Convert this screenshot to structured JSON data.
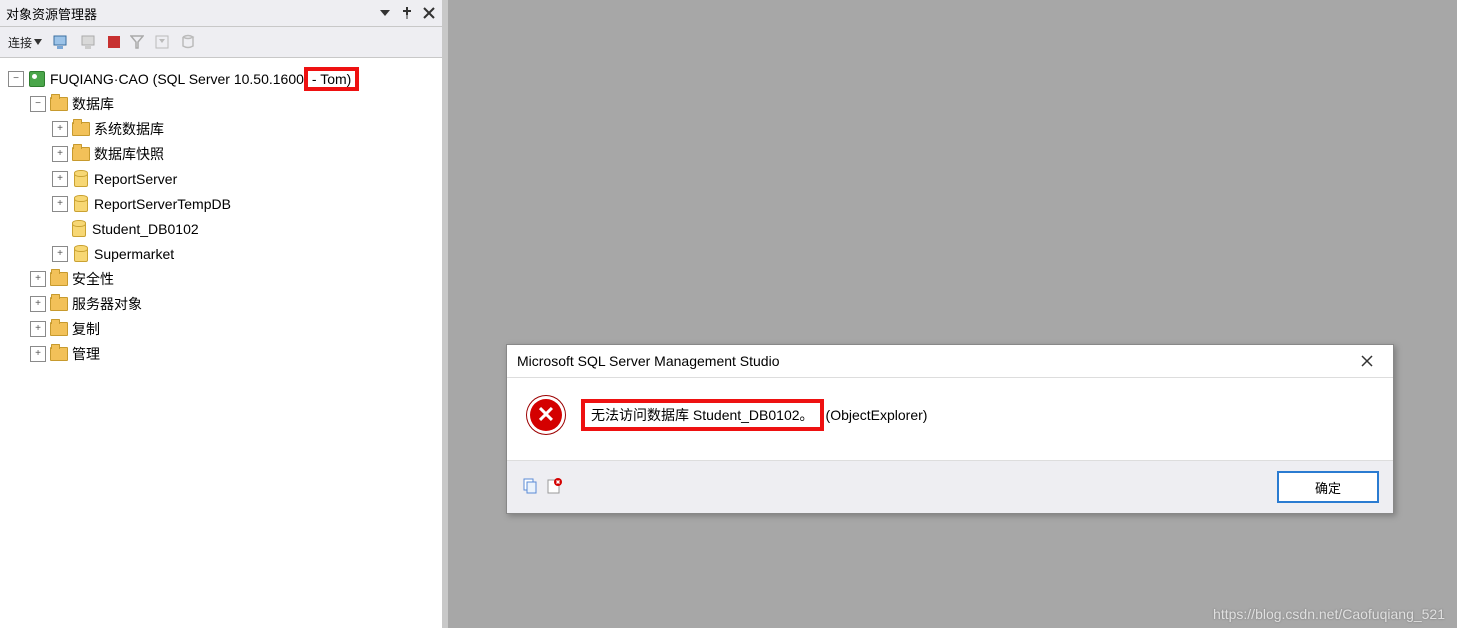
{
  "panel": {
    "title": "对象资源管理器",
    "toolbar": {
      "connect_label": "连接"
    }
  },
  "tree": {
    "root": {
      "label_pre": "FUQIANG·CAO (SQL Server 10.50.1600",
      "label_boxed": "- Tom)"
    },
    "databases": {
      "label": "数据库",
      "children": [
        {
          "key": "sysdb",
          "label": "系统数据库",
          "type": "folder",
          "expandable": true
        },
        {
          "key": "snapshot",
          "label": "数据库快照",
          "type": "folder",
          "expandable": true
        },
        {
          "key": "reportserver",
          "label": "ReportServer",
          "type": "db",
          "expandable": true
        },
        {
          "key": "reportservertemp",
          "label": "ReportServerTempDB",
          "type": "db",
          "expandable": true
        },
        {
          "key": "student",
          "label": "Student_DB0102",
          "type": "db",
          "expandable": false
        },
        {
          "key": "supermarket",
          "label": "Supermarket",
          "type": "db",
          "expandable": true
        }
      ]
    },
    "siblings": [
      {
        "key": "security",
        "label": "安全性"
      },
      {
        "key": "serverobj",
        "label": "服务器对象"
      },
      {
        "key": "replication",
        "label": "复制"
      },
      {
        "key": "management",
        "label": "管理"
      }
    ]
  },
  "dialog": {
    "title": "Microsoft SQL Server Management Studio",
    "message_boxed": "无法访问数据库 Student_DB0102。",
    "message_tail": "(ObjectExplorer)",
    "ok_label": "确定"
  },
  "watermark": "https://blog.csdn.net/Caofuqiang_521"
}
